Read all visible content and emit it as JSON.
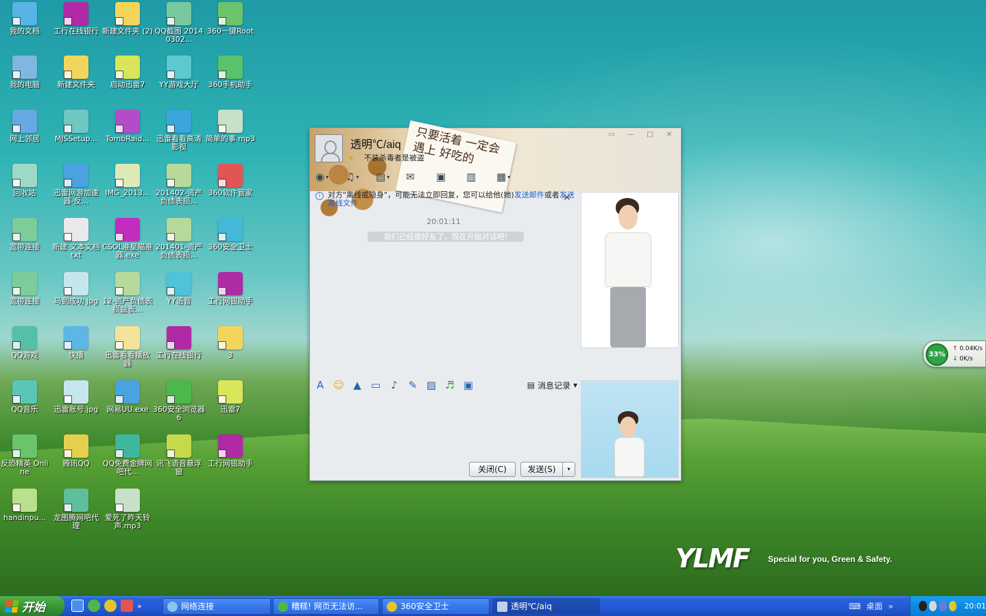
{
  "desktop": {
    "icons": [
      {
        "label": "我的文档",
        "color": "#58b4e6"
      },
      {
        "label": "工行在线银行",
        "color": "#b02aa6"
      },
      {
        "label": "新建文件夹 (2)",
        "color": "#f2d65c"
      },
      {
        "label": "QQ截图 20140302...",
        "color": "#79c9a0"
      },
      {
        "label": "360一键Root",
        "color": "#6bc46b"
      },
      {
        "label": "我的电脑",
        "color": "#7fb7e0"
      },
      {
        "label": "新建文件夹",
        "color": "#f2d65c"
      },
      {
        "label": "启动迅雷7",
        "color": "#d9e65a"
      },
      {
        "label": "YY游戏大厅",
        "color": "#5cc8d0"
      },
      {
        "label": "360手机助手",
        "color": "#5ac26c"
      },
      {
        "label": "网上邻居",
        "color": "#66a9e0"
      },
      {
        "label": "MJSSetup...",
        "color": "#6ec7c0"
      },
      {
        "label": "TombRaid...",
        "color": "#b44cc9"
      },
      {
        "label": "迅雷看看高清影视",
        "color": "#3aa6d9"
      },
      {
        "label": "简单的事 mp3",
        "color": "#c8e0c8"
      },
      {
        "label": "回收站",
        "color": "#9cd9c6"
      },
      {
        "label": "迅雷网游加速器-反...",
        "color": "#4aa2e0"
      },
      {
        "label": "IMG_2013...",
        "color": "#dfe9b8"
      },
      {
        "label": "201402-资产负债表损...",
        "color": "#b7d99a"
      },
      {
        "label": "360软件管家",
        "color": "#e25555"
      },
      {
        "label": "宽带连接",
        "color": "#7ccc9c"
      },
      {
        "label": "新建 文本文档 txt",
        "color": "#eaeaea"
      },
      {
        "label": "CSOL准星瞄准器.exe",
        "color": "#c22dc0"
      },
      {
        "label": "201401-资产负债表损...",
        "color": "#b7d99a"
      },
      {
        "label": "360安全卫士",
        "color": "#44b8d8"
      },
      {
        "label": "宽带连接",
        "color": "#7ccc9c"
      },
      {
        "label": "马到成功 jpg",
        "color": "#c6e6ee"
      },
      {
        "label": "12-资产负债表损益表...",
        "color": "#b7d99a"
      },
      {
        "label": "YY语音",
        "color": "#50c3d8"
      },
      {
        "label": "工行网银助手",
        "color": "#b02aa6"
      },
      {
        "label": "QQ游戏",
        "color": "#56bfa9"
      },
      {
        "label": "快播",
        "color": "#5cb7e4"
      },
      {
        "label": "迅雷看看播放器",
        "color": "#f4e49a"
      },
      {
        "label": "工行在线银行",
        "color": "#b02aa6"
      },
      {
        "label": "3",
        "color": "#f2d65c"
      },
      {
        "label": "QQ音乐",
        "color": "#5ac6b8"
      },
      {
        "label": "迅雷账号.jpg",
        "color": "#c6e6ee"
      },
      {
        "label": "网易UU.exe",
        "color": "#4aa2e0"
      },
      {
        "label": "360安全浏览器6",
        "color": "#4cb84c"
      },
      {
        "label": "迅雷7",
        "color": "#d9e65a"
      },
      {
        "label": "反恐精英 Online",
        "color": "#6bc46b"
      },
      {
        "label": "腾讯QQ",
        "color": "#e4d04c"
      },
      {
        "label": "QQ免费金牌网吧代...",
        "color": "#3fb6a0"
      },
      {
        "label": "讯飞语音悬浮窗",
        "color": "#c6d94c"
      },
      {
        "label": "工行网银助手",
        "color": "#b02aa6"
      },
      {
        "label": "handinpu...",
        "color": "#b9e08c"
      },
      {
        "label": "龙图腾网吧代理",
        "color": "#5ebf9c"
      },
      {
        "label": "爱死了昨天铃声.mp3",
        "color": "#c8e0c8"
      }
    ]
  },
  "chat": {
    "contact_name": "透明℃/aiq",
    "signature": "不装杀毒者是被盗",
    "note_text": "只要活着 一定会遇上 好吃的",
    "notice_prefix": "对方\"离线或隐身\"，可能无法立即回复，您可以给他(她)",
    "notice_link1": "发送邮件",
    "notice_mid": "或者",
    "notice_link2": "发送离线文件",
    "time": "20:01:11",
    "system_msg": "我们已经是好友了，现在开始对话吧!",
    "history_label": "消息记录",
    "close_label": "关闭(C)",
    "send_label": "发送(S)"
  },
  "widget": {
    "percent": "33%",
    "up": "0.04K/s",
    "down": "0K/s"
  },
  "brand": {
    "logo": "YLMF",
    "tagline": "Special for you, Green & Safety."
  },
  "taskbar": {
    "start_label": "开始",
    "tasks": [
      {
        "label": "网络连接"
      },
      {
        "label": "糟糕! 网页无法访..."
      },
      {
        "label": "360安全卫士"
      },
      {
        "label": "透明℃/aiq"
      }
    ],
    "desktop_label": "桌面",
    "clock": "20:01"
  }
}
